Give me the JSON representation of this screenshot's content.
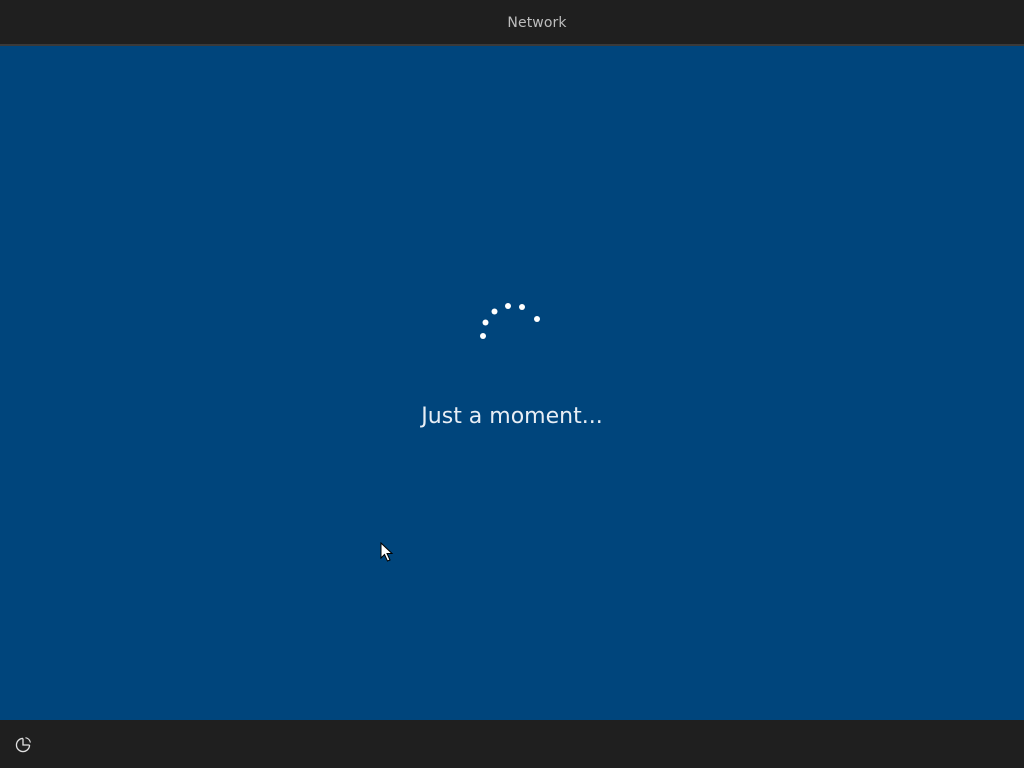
{
  "header": {
    "tabs": [
      {
        "label": "Network",
        "active": true
      }
    ]
  },
  "main": {
    "status_text": "Just a moment...",
    "background_color": "#00457c"
  },
  "footer": {
    "accessibility_icon": "ease-of-access-icon"
  },
  "colors": {
    "bar_background": "#1f1f1f",
    "accent": "#ffffff",
    "text": "#e8eef5"
  }
}
